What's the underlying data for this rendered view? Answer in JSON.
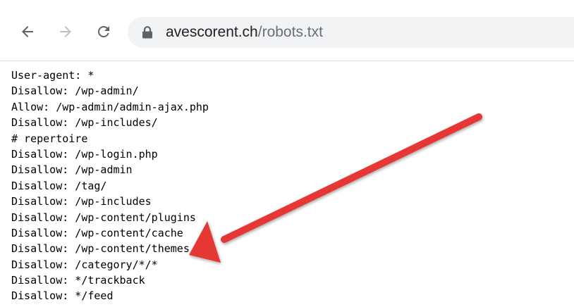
{
  "browser": {
    "url_host": "avescorent.ch",
    "url_path": "/robots.txt",
    "icons": {
      "back": "back-arrow-icon",
      "forward": "forward-arrow-icon",
      "reload": "reload-icon",
      "secure": "lock-icon"
    }
  },
  "robots_txt": {
    "lines": [
      "User-agent: *",
      "Disallow: /wp-admin/",
      "Allow: /wp-admin/admin-ajax.php",
      "Disallow: /wp-includes/",
      "# repertoire",
      "Disallow: /wp-login.php",
      "Disallow: /wp-admin",
      "Disallow: /tag/",
      "Disallow: /wp-includes",
      "Disallow: /wp-content/plugins",
      "Disallow: /wp-content/cache",
      "Disallow: /wp-content/themes",
      "Disallow: /category/*/*",
      "Disallow: */trackback",
      "Disallow: */feed"
    ]
  },
  "annotation": {
    "arrow_color": "#e53935"
  }
}
